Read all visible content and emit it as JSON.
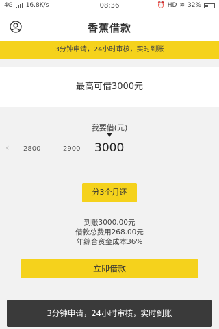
{
  "status_bar": {
    "network": "4G",
    "speed": "16.8K/s",
    "time": "08:36",
    "hd": "HD",
    "battery": "32%",
    "battery_level": 0.32
  },
  "header": {
    "title": "香蕉借款",
    "avatar_icon": "user-circle-icon"
  },
  "notice_top": "3分钟申请，24小时审核，实时到账",
  "max_loan": "最高可借3000元",
  "amount_picker": {
    "label": "我要借(元)",
    "options": [
      "2800",
      "2900"
    ],
    "selected": "3000"
  },
  "repay_button": "分3个月还",
  "summary": {
    "received": "到账3000.00元",
    "total_fee": "借款总费用268.00元",
    "annual_rate": "年综合资金成本36%"
  },
  "apply_button": "立即借款",
  "toast": "3分钟申请，24小时审核，实时到账",
  "colors": {
    "accent": "#f5d21c",
    "toast_bg": "#3a3a3a"
  }
}
